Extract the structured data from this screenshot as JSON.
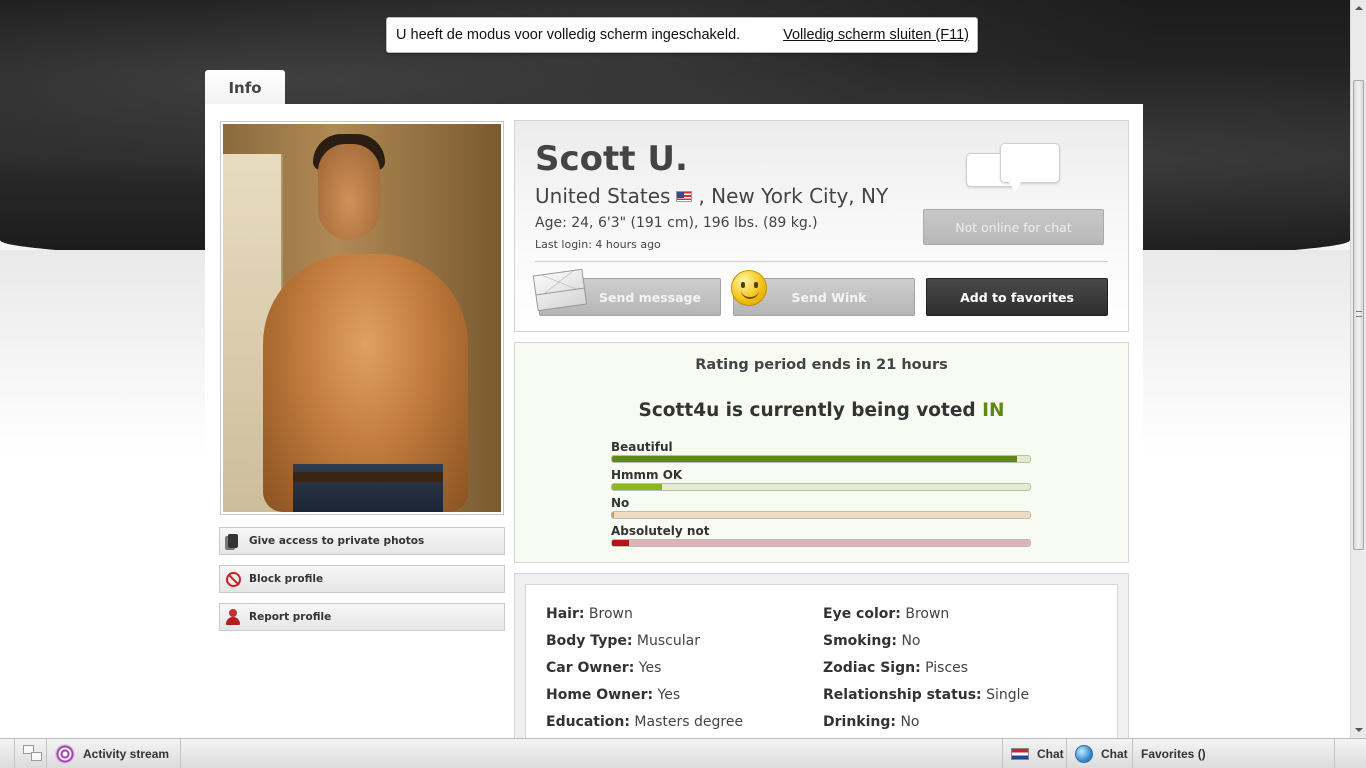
{
  "fullscreen_notice": {
    "message": "U heeft de modus voor volledig scherm ingeschakeld.",
    "link": "Volledig scherm sluiten (F11)"
  },
  "tabs": [
    {
      "label": "Info"
    }
  ],
  "profile": {
    "name": "Scott U.",
    "country": "United States",
    "city": ", New York City, NY",
    "stats": "Age: 24, 6'3\" (191 cm), 196 lbs. (89 kg.)",
    "last_login": "Last login: 4 hours ago",
    "chat_status": "Not online for chat"
  },
  "actions": {
    "send_message": "Send message",
    "send_wink": "Send Wink",
    "add_favorites": "Add to favorites"
  },
  "side_buttons": {
    "private_photos": "Give access to private photos",
    "block": "Block profile",
    "report": "Report profile"
  },
  "rating": {
    "period": "Rating period ends in 21 hours",
    "voted_prefix": "Scott4u is currently being voted ",
    "voted_status": "IN",
    "bars": [
      {
        "label": "Beautiful",
        "fraction": 0.97,
        "fill_color": "#5f8a12",
        "track_color": "#e2eac8"
      },
      {
        "label": "Hmmm OK",
        "fraction": 0.12,
        "fill_color": "#8cb71c",
        "track_color": "#e5ecd2"
      },
      {
        "label": "No",
        "fraction": 0.005,
        "fill_color": "#c89a50",
        "track_color": "#eddcc2"
      },
      {
        "label": "Absolutely not",
        "fraction": 0.04,
        "fill_color": "#b81414",
        "track_color": "#dfb4b8"
      }
    ]
  },
  "details": {
    "left": [
      {
        "key": "Hair:",
        "value": " Brown"
      },
      {
        "key": "Body Type:",
        "value": " Muscular"
      },
      {
        "key": "Car Owner:",
        "value": " Yes"
      },
      {
        "key": "Home Owner:",
        "value": " Yes"
      },
      {
        "key": "Education:",
        "value": " Masters degree"
      }
    ],
    "right": [
      {
        "key": "Eye color:",
        "value": " Brown"
      },
      {
        "key": "Smoking:",
        "value": " No"
      },
      {
        "key": "Zodiac Sign:",
        "value": " Pisces"
      },
      {
        "key": "Relationship status:",
        "value": " Single"
      },
      {
        "key": "Drinking:",
        "value": " No"
      }
    ]
  },
  "bottom_bar": {
    "activity": "Activity stream",
    "chat1": "Chat",
    "chat2": "Chat",
    "favorites": "Favorites ()"
  }
}
